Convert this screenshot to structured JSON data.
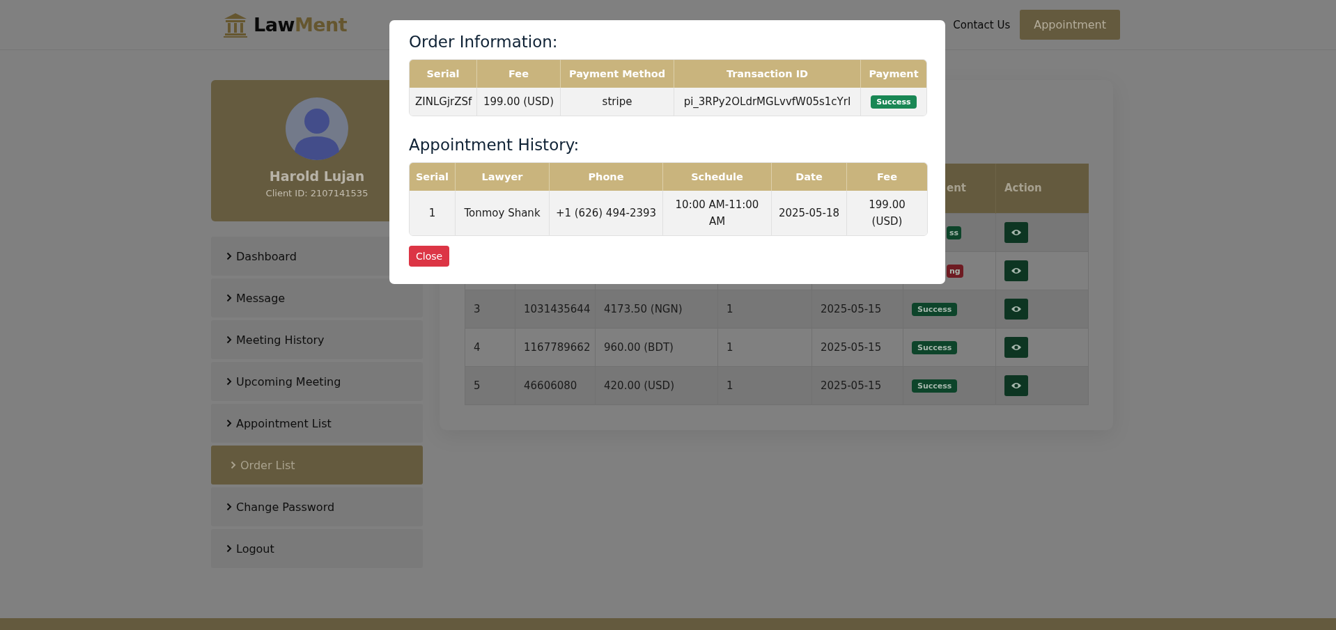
{
  "header": {
    "logo": {
      "first": "Law",
      "second": "Ment"
    },
    "nav": [
      {
        "label": "Contact Us"
      }
    ],
    "appointment_button": "Appointment"
  },
  "sidebar": {
    "profile": {
      "name": "Harold Lujan",
      "client_id": "Client ID: 2107141535"
    },
    "items": [
      {
        "label": "Dashboard",
        "selected": false
      },
      {
        "label": "Message",
        "selected": false
      },
      {
        "label": "Meeting History",
        "selected": false
      },
      {
        "label": "Upcoming Meeting",
        "selected": false
      },
      {
        "label": "Appointment List",
        "selected": false
      },
      {
        "label": "Order List",
        "selected": true
      },
      {
        "label": "Change Password",
        "selected": false
      },
      {
        "label": "Logout",
        "selected": false
      }
    ]
  },
  "orders_table": {
    "columns": [
      {
        "label": "ent"
      },
      {
        "label": "Action"
      }
    ],
    "rows": [
      {
        "status": {
          "label": "ss",
          "color": "#0d442a"
        }
      },
      {
        "status": {
          "label": "ng",
          "color": "#6e1b22"
        }
      },
      {
        "column_1": "3",
        "column_2": "1031435644",
        "column_3": "4173.50 (NGN)",
        "column_4": "1",
        "column_5": "2025-05-15",
        "status": {
          "label": "Success",
          "color": "#0d442a"
        }
      },
      {
        "column_1": "4",
        "column_2": "1167789662",
        "column_3": "960.00 (BDT)",
        "column_4": "1",
        "column_5": "2025-05-15",
        "status": {
          "label": "Success",
          "color": "#0d442a"
        }
      },
      {
        "column_1": "5",
        "column_2": "46606080",
        "column_3": "420.00 (USD)",
        "column_4": "1",
        "column_5": "2025-05-15",
        "status": {
          "label": "Success",
          "color": "#0d442a"
        }
      }
    ]
  },
  "modal": {
    "order_information": {
      "title": "Order Information:",
      "columns": [
        "Serial",
        "Fee",
        "Payment Method",
        "Transaction ID",
        "Payment"
      ],
      "rows": [
        {
          "cells": [
            "ZINLGjrZSf",
            "199.00 (USD)",
            "stripe",
            "pi_3RPy2OLdrMGLvvfW05s1cYrI"
          ],
          "payment": {
            "label": "Success",
            "color": "#198754"
          }
        }
      ]
    },
    "appointment_history": {
      "title": "Appointment History:",
      "columns": [
        "Serial",
        "Lawyer",
        "Phone",
        "Schedule",
        "Date",
        "Fee"
      ],
      "rows": [
        {
          "cells": [
            "1",
            "Tonmoy Shank",
            "+1 (626) 494-2393",
            "10:00 AM-11:00 AM",
            "2025-05-18",
            "199.00 (USD)"
          ]
        }
      ]
    },
    "close_button": "Close"
  }
}
